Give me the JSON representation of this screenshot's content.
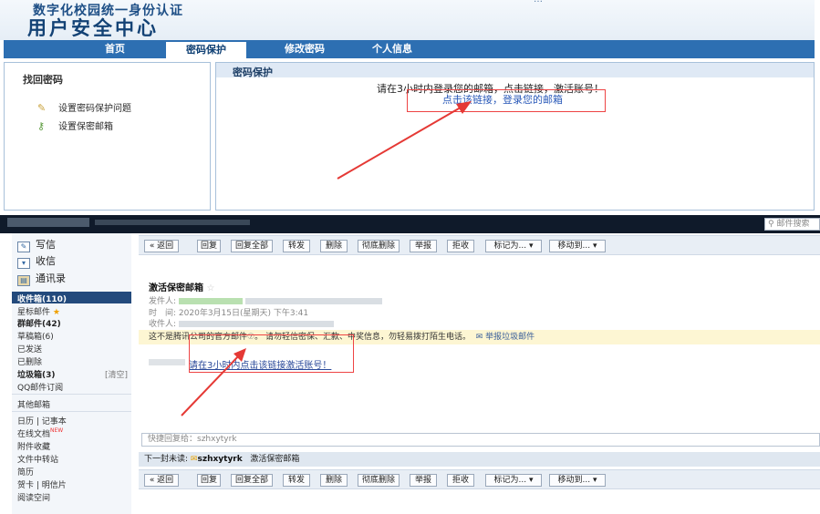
{
  "portal": {
    "subtitle": "数字化校园统一身份认证",
    "title": "用户安全中心",
    "header_right": "…",
    "nav": [
      {
        "label": "首页"
      },
      {
        "label": "密码保护"
      },
      {
        "label": "修改密码"
      },
      {
        "label": "个人信息"
      }
    ],
    "left_panel": {
      "title": "找回密码",
      "items": [
        {
          "label": "设置密码保护问题"
        },
        {
          "label": "设置保密邮箱"
        }
      ]
    },
    "main_panel": {
      "title": "密码保护",
      "message": "请在3小时内登录您的邮箱，点击链接，激活账号！",
      "link": "点击该链接，登录您的邮箱"
    }
  },
  "mail": {
    "search_placeholder": "邮件搜索",
    "sidebar": {
      "write": "写信",
      "inbox_btn": "收信",
      "contacts": "通讯录",
      "items": [
        {
          "label": "收件箱(110)"
        },
        {
          "label": "星标邮件"
        },
        {
          "label": "群邮件(42)"
        },
        {
          "label": "草稿箱(6)"
        },
        {
          "label": "已发送"
        },
        {
          "label": "已删除"
        },
        {
          "label": "垃圾箱(3)"
        },
        {
          "label": "QQ邮件订阅"
        },
        {
          "label": "其他邮箱"
        },
        {
          "label": "日历 | 记事本"
        },
        {
          "label": "在线文档"
        },
        {
          "label": "附件收藏"
        },
        {
          "label": "文件中转站"
        },
        {
          "label": "简历"
        },
        {
          "label": "贺卡 | 明信片"
        },
        {
          "label": "阅读空间"
        }
      ],
      "clear": "[清空]",
      "new_tag": "NEW"
    },
    "toolbar": [
      {
        "label": "« 返回"
      },
      {
        "label": "回复"
      },
      {
        "label": "回复全部"
      },
      {
        "label": "转发"
      },
      {
        "label": "删除"
      },
      {
        "label": "彻底删除"
      },
      {
        "label": "举报"
      },
      {
        "label": "拒收"
      },
      {
        "label": "标记为... ▾"
      },
      {
        "label": "移动到... ▾"
      }
    ],
    "message": {
      "subject": "激活保密邮箱",
      "from_label": "发件人:",
      "time_label": "时　间:",
      "time_value": "2020年3月15日(星期天) 下午3:41",
      "to_label": "收件人:",
      "warning": "这不是腾讯公司的官方邮件",
      "warning_rest": "。 请勿轻信密保、汇款、中奖信息，勿轻易拨打陌生电话。",
      "report": "举报垃圾邮件",
      "body_link": "请在3小时内点击该链接激活账号！",
      "quick_reply": "快捷回复给：szhxytyrk",
      "next_label": "下一封未读:",
      "next_sender": "szhxytyrk",
      "next_subject": "激活保密邮箱"
    }
  }
}
